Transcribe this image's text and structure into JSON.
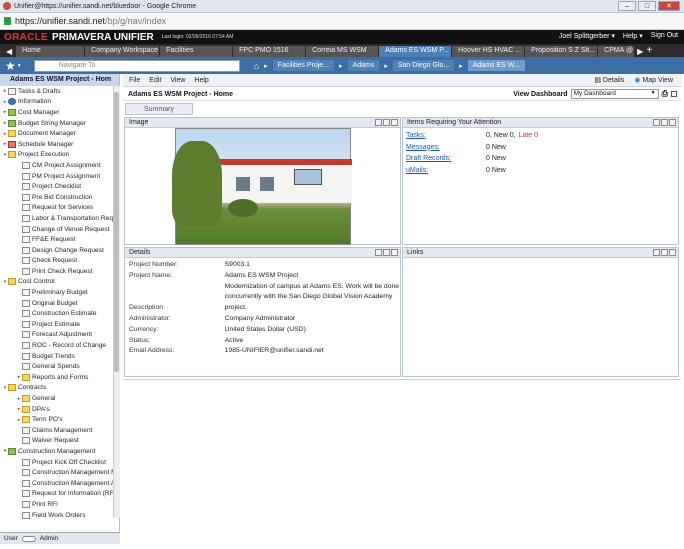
{
  "browser": {
    "window_title": "Unifier@https://unifier.sandi.net/bluedoor - Google Chrome",
    "url_host": "https://unifier.sandi.net",
    "url_path": "/bp/g/nav/index"
  },
  "header": {
    "logo_oracle": "ORACLE",
    "logo_product": "PRIMAVERA UNIFIER",
    "last_login": "Last login: 02/26/2016 07:54 AM",
    "user": "Joel Splittgerber ▾",
    "help": "Help ▾",
    "signout": "Sign Out"
  },
  "tabs": [
    {
      "label": "Home"
    },
    {
      "label": "Company Workspace"
    },
    {
      "label": "Facilities"
    },
    {
      "label": "FPC PMO 1516"
    },
    {
      "label": "Correia MS WSM"
    },
    {
      "label": "Adams ES WSM P... ×"
    },
    {
      "label": "Hoover HS HVAC ..."
    },
    {
      "label": "Proposition S Z Sit..."
    },
    {
      "label": "CPMA @"
    }
  ],
  "nav": {
    "search_placeholder": "Navigate To",
    "breadcrumbs": [
      "Facilities Proje...",
      "Adams",
      "San Diego Glo...",
      "Adams ES W..."
    ]
  },
  "sidebar": {
    "title": "Adams ES WSM Project - Hom",
    "items": [
      {
        "label": "Tasks & Drafts",
        "level": 0,
        "icon": "tasks-icon"
      },
      {
        "label": "Information",
        "level": 0,
        "icon": "info-icon"
      },
      {
        "label": "Cost Manager",
        "level": 0,
        "icon": "cost-icon"
      },
      {
        "label": "Budget String Manager",
        "level": 0,
        "icon": "budget-icon"
      },
      {
        "label": "Document Manager",
        "level": 0,
        "icon": "document-icon"
      },
      {
        "label": "Schedule Manager",
        "level": 0,
        "icon": "schedule-icon"
      },
      {
        "label": "Project Execution",
        "level": 0,
        "icon": "folder-icon",
        "open": true
      },
      {
        "label": "CM Project Assignment",
        "level": 1,
        "icon": "form-icon"
      },
      {
        "label": "PM Project Assignment",
        "level": 1,
        "icon": "form-icon"
      },
      {
        "label": "Project Checklist",
        "level": 1,
        "icon": "form-icon"
      },
      {
        "label": "Pre Bid Construction",
        "level": 1,
        "icon": "form-icon"
      },
      {
        "label": "Request for Services",
        "level": 1,
        "icon": "form-icon"
      },
      {
        "label": "Labor & Transportation Requ",
        "level": 1,
        "icon": "form-icon"
      },
      {
        "label": "Change of Venue Request",
        "level": 1,
        "icon": "form-icon"
      },
      {
        "label": "FF&E Request",
        "level": 1,
        "icon": "form-icon"
      },
      {
        "label": "Design Change Request",
        "level": 1,
        "icon": "form-icon"
      },
      {
        "label": "Check Request",
        "level": 1,
        "icon": "form-icon"
      },
      {
        "label": "Print Check Request",
        "level": 1,
        "icon": "form-icon"
      },
      {
        "label": "Cost Control",
        "level": 0,
        "icon": "folder-icon",
        "open": true
      },
      {
        "label": "Preliminary Budget",
        "level": 1,
        "icon": "form-icon"
      },
      {
        "label": "Original Budget",
        "level": 1,
        "icon": "form-icon"
      },
      {
        "label": "Construction Estimate",
        "level": 1,
        "icon": "form-icon"
      },
      {
        "label": "Project Estimate",
        "level": 1,
        "icon": "form-icon"
      },
      {
        "label": "Forecast Adjustment",
        "level": 1,
        "icon": "form-icon"
      },
      {
        "label": "ROC - Record of Change",
        "level": 1,
        "icon": "form-icon"
      },
      {
        "label": "Budget Trends",
        "level": 1,
        "icon": "form-icon"
      },
      {
        "label": "General Spends",
        "level": 1,
        "icon": "form-icon"
      },
      {
        "label": "Reports and Forms",
        "level": 1,
        "icon": "folder-icon"
      },
      {
        "label": "Contracts",
        "level": 0,
        "icon": "folder-icon",
        "open": true
      },
      {
        "label": "General",
        "level": 1,
        "icon": "folder-icon"
      },
      {
        "label": "DPA's",
        "level": 1,
        "icon": "folder-icon"
      },
      {
        "label": "Term PO's",
        "level": 1,
        "icon": "folder-icon"
      },
      {
        "label": "Claims Management",
        "level": 1,
        "icon": "form-icon"
      },
      {
        "label": "Waiver Request",
        "level": 1,
        "icon": "form-icon"
      },
      {
        "label": "Construction Management",
        "level": 0,
        "icon": "construction-icon",
        "open": true
      },
      {
        "label": "Project Kick Off Checklist",
        "level": 1,
        "icon": "form-icon"
      },
      {
        "label": "Construction Management M",
        "level": 1,
        "icon": "form-icon"
      },
      {
        "label": "Construction Management A",
        "level": 1,
        "icon": "form-icon"
      },
      {
        "label": "Request for Information (RFI",
        "level": 1,
        "icon": "form-icon"
      },
      {
        "label": "Print RFI",
        "level": 1,
        "icon": "form-icon"
      },
      {
        "label": "Field Work Orders",
        "level": 1,
        "icon": "form-icon"
      }
    ],
    "footer_user": "User",
    "footer_admin": "Admin"
  },
  "menubar": {
    "items": [
      "File",
      "Edit",
      "View",
      "Help"
    ],
    "details": "Details",
    "map_view": "Map View"
  },
  "project": {
    "title": "Adams ES WSM Project - Home",
    "view_dashboard_label": "View Dashboard",
    "dashboard_value": "My Dashboard",
    "summary_tab": "Summary"
  },
  "image_panel": {
    "title": "Image"
  },
  "attention_panel": {
    "title": "Items Requiring Your Attention",
    "rows": [
      {
        "label": "Tasks:",
        "value": "0, New 0,",
        "late": "Late 0"
      },
      {
        "label": "Messages:",
        "value": "0 New",
        "late": ""
      },
      {
        "label": "Draft Records:",
        "value": "0 New",
        "late": ""
      },
      {
        "label": "uMails:",
        "value": "0 New",
        "late": ""
      }
    ]
  },
  "details_panel": {
    "title": "Details",
    "rows": [
      {
        "key": "Project Number:",
        "value": "S9003.1"
      },
      {
        "key": "Project Name:",
        "value": "Adams ES WSM Project"
      },
      {
        "key": "",
        "value": "Modernization of campus at Adams ES. Work will be done concurrently with the San Diego Global Vision Academy"
      },
      {
        "key": "Description:",
        "value": "project."
      },
      {
        "key": "Administrator:",
        "value": "Company Administrator"
      },
      {
        "key": "Currency:",
        "value": "United States Dollar (USD)"
      },
      {
        "key": "Status:",
        "value": "Active"
      },
      {
        "key": "Email Address:",
        "value": "1985-UNIFIER@unifier.sandi.net"
      }
    ]
  },
  "links_panel": {
    "title": "Links"
  },
  "colors": {
    "accent": "#3b6ea5",
    "late": "#d32f2f",
    "oracle_red": "#e2342b"
  }
}
